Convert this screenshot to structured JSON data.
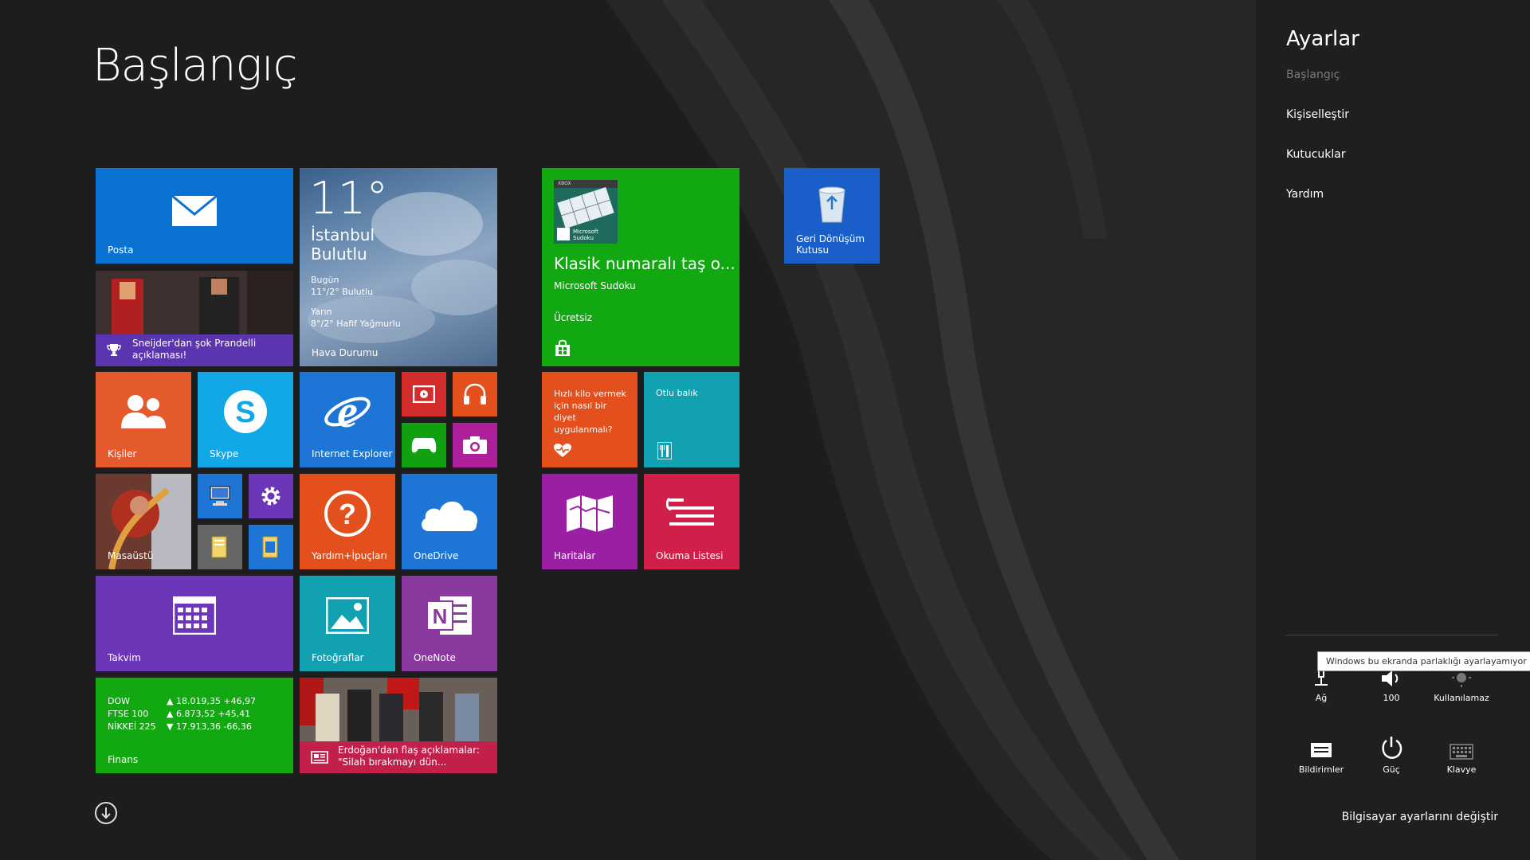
{
  "start": {
    "title": "Başlangıç"
  },
  "tiles": {
    "mail": "Posta",
    "sports_news": "Sneijder'dan şok Prandelli açıklaması!",
    "weather": {
      "temp": "11°",
      "city": "İstanbul",
      "condition": "Bulutlu",
      "today_label": "Bugün",
      "today_value": "11°/2° Bulutlu",
      "tomorrow_label": "Yarın",
      "tomorrow_value": "8°/2° Hafif Yağmurlu",
      "app_name": "Hava Durumu"
    },
    "sudoku": {
      "title": "Klasik numaralı taş o...",
      "publisher": "Microsoft Sudoku",
      "price": "Ücretsiz",
      "badge_small": "Microsoft Sudoku",
      "badge_xbox": "XBOX"
    },
    "recycle_bin": "Geri Dönüşüm Kutusu",
    "people": "Kişiler",
    "skype": "Skype",
    "ie": "Internet Explorer",
    "health": "Hızlı kilo vermek için nasıl bir diyet uygulanmalı?",
    "food": "Otlu balık",
    "desktop": "Masaüstü",
    "help": "Yardım+İpuçları",
    "onedrive": "OneDrive",
    "maps": "Haritalar",
    "reading_list": "Okuma Listesi",
    "calendar": "Takvim",
    "photos": "Fotoğraflar",
    "onenote": "OneNote",
    "finance": {
      "app_name": "Finans",
      "rows": [
        {
          "name": "DOW",
          "value": "▲ 18.019,35 +46,97"
        },
        {
          "name": "FTSE 100",
          "value": "▲ 6.873,52 +45,41"
        },
        {
          "name": "NİKKEİ 225",
          "value": "▼ 17.913,36 -66,36"
        }
      ]
    },
    "news": "Erdoğan'dan flaş açıklamalar: \"Silah bırakmayı dün..."
  },
  "charms": {
    "title": "Ayarlar",
    "subtitle": "Başlangıç",
    "items": [
      "Kişiselleştir",
      "Kutucuklar",
      "Yardım"
    ],
    "tooltip": "Windows bu ekranda parlaklığı ayarlayamıyor",
    "quick": [
      {
        "label": "Ağ",
        "icon": "network-icon"
      },
      {
        "label": "100",
        "icon": "volume-icon"
      },
      {
        "label": "Kullanılamaz",
        "icon": "brightness-icon"
      },
      {
        "label": "Bildirimler",
        "icon": "notifications-icon"
      },
      {
        "label": "Güç",
        "icon": "power-icon"
      },
      {
        "label": "Klavye",
        "icon": "keyboard-icon"
      }
    ],
    "pc_settings": "Bilgisayar ayarlarını değiştir"
  },
  "colors": {
    "mail": "#0a72d2",
    "sports": "#5b34b0",
    "sudoku": "#12a812",
    "recycle": "#1a5fc9",
    "people": "#e55a2c",
    "skype": "#12a7e6",
    "ie": "#1d76d6",
    "video": "#d22c2c",
    "music": "#e3501e",
    "games": "#10a010",
    "camera": "#ad1f9b",
    "health": "#e3501e",
    "food": "#11a1b0",
    "help": "#e3501e",
    "onedrive": "#1d76d6",
    "maps": "#9a1fa3",
    "reading": "#d0204a",
    "calendar": "#6c36b8",
    "photos": "#12a1b0",
    "onenote": "#8a3a9e",
    "finance": "#12a812",
    "news": "#c2204a"
  }
}
